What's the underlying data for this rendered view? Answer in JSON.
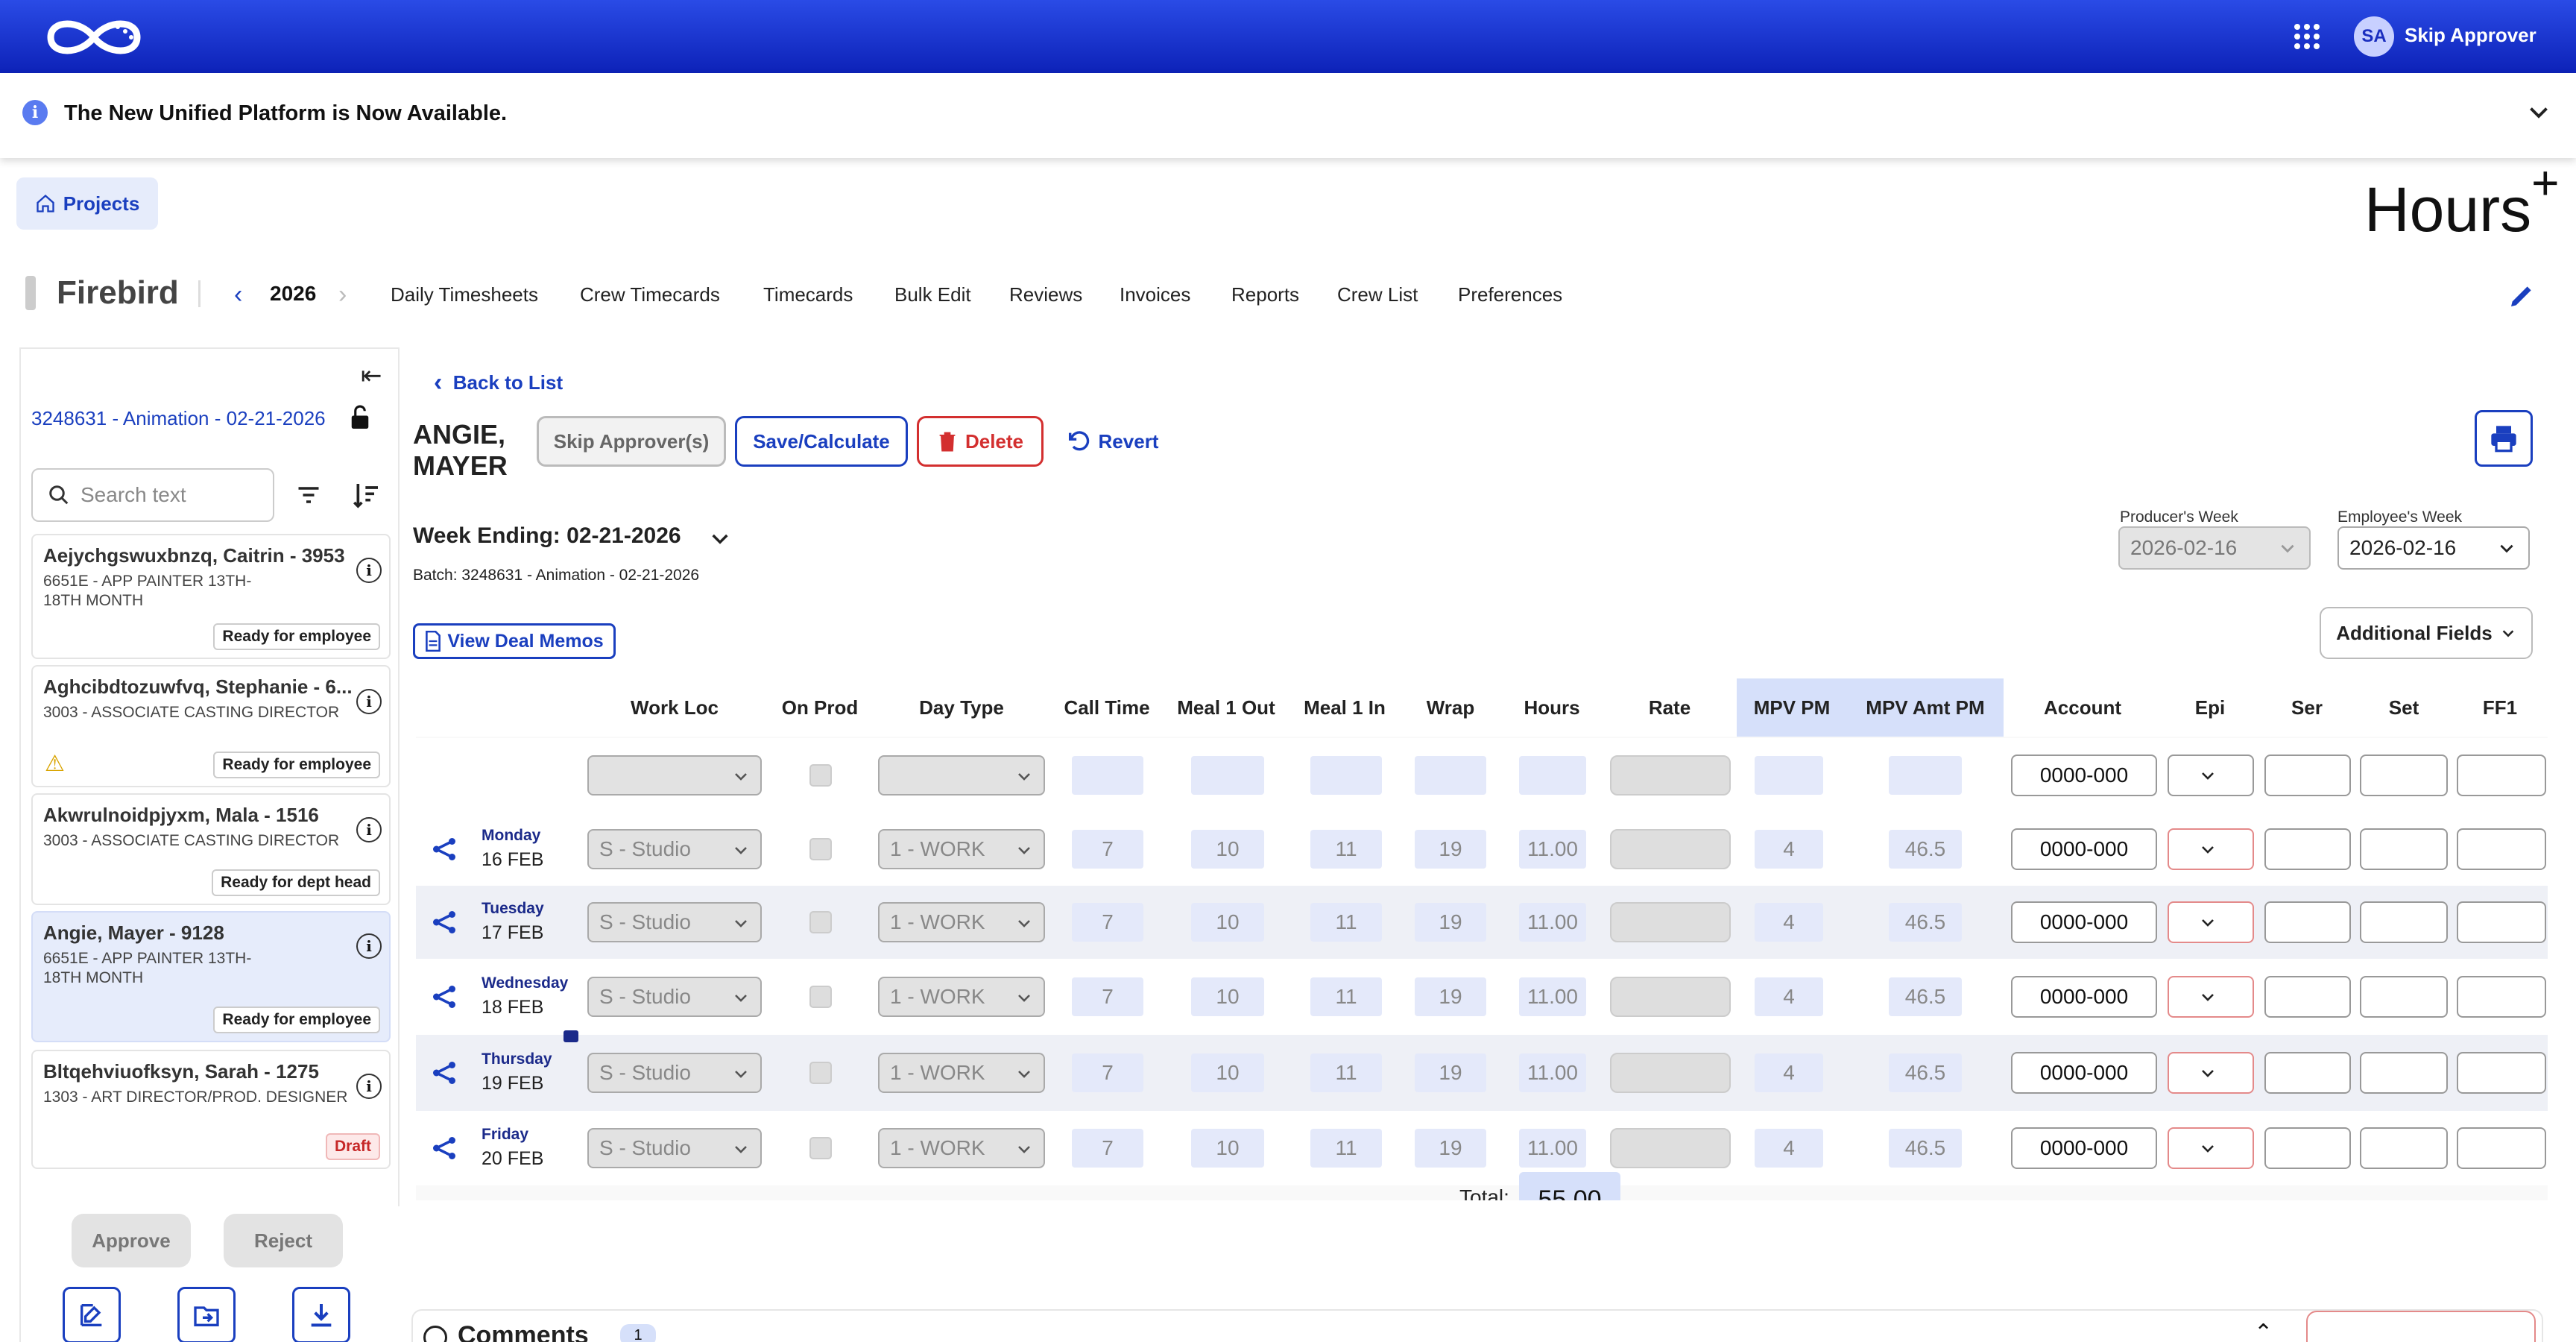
{
  "header": {
    "user_initials": "SA",
    "user_name": "Skip Approver"
  },
  "banner": {
    "text": "The New Unified Platform is Now Available."
  },
  "projects_button": "Projects",
  "brand": {
    "name": "Hours",
    "sup": "+"
  },
  "nav": {
    "project": "Firebird",
    "year": "2026",
    "links": [
      "Daily Timesheets",
      "Crew Timecards",
      "Timecards",
      "Bulk Edit",
      "Reviews",
      "Invoices",
      "Reports",
      "Crew List",
      "Preferences"
    ]
  },
  "sidebar": {
    "batch": "3248631 - Animation - 02-21-2026",
    "search_placeholder": "Search text",
    "employees": [
      {
        "name": "Aejychgswuxbnzq, Caitrin - 3953",
        "role": "6651E - APP PAINTER 13TH-18TH MONTH",
        "status": "Ready for employee"
      },
      {
        "name": "Aghcibdtozuwfvq, Stephanie - 6...",
        "role": "3003 - ASSOCIATE CASTING DIRECTOR",
        "status": "Ready for employee"
      },
      {
        "name": "Akwrulnoidpjyxm, Mala - 1516",
        "role": "3003 - ASSOCIATE CASTING DIRECTOR",
        "status": "Ready for dept head"
      },
      {
        "name": "Angie, Mayer - 9128",
        "role": "6651E - APP PAINTER 13TH-18TH MONTH",
        "status": "Ready for employee"
      },
      {
        "name": "Bltqehviuofksyn, Sarah - 1275",
        "role": "1303 - ART DIRECTOR/PROD. DESIGNER",
        "status": "Draft"
      }
    ],
    "approve": "Approve",
    "reject": "Reject"
  },
  "main": {
    "back": "Back to List",
    "employee_name": "ANGIE, MAYER",
    "buttons": {
      "skip": "Skip Approver(s)",
      "save": "Save/Calculate",
      "delete": "Delete",
      "revert": "Revert"
    },
    "week_ending": "Week Ending: 02-21-2026",
    "batch_line": "Batch: 3248631 - Animation - 02-21-2026",
    "producers_week_label": "Producer's Week",
    "producers_week": "2026-02-16",
    "employees_week_label": "Employee's Week",
    "employees_week": "2026-02-16",
    "deal_memos": "View Deal Memos",
    "additional_fields": "Additional Fields",
    "columns": [
      "Work Loc",
      "On Prod",
      "Day Type",
      "Call Time",
      "Meal 1 Out",
      "Meal 1 In",
      "Wrap",
      "Hours",
      "Rate",
      "MPV PM",
      "MPV Amt PM",
      "Account",
      "Epi",
      "Ser",
      "Set",
      "FF1"
    ],
    "blank_account": "0000-000",
    "days": [
      {
        "day": "Monday",
        "date": "16 FEB",
        "work_loc": "S - Studio",
        "day_type": "1 - WORK",
        "call": "7",
        "meal_out": "10",
        "meal_in": "11",
        "wrap": "19",
        "hours": "11.00",
        "mpv": "4",
        "mpv_amt": "46.5",
        "account": "0000-000"
      },
      {
        "day": "Tuesday",
        "date": "17 FEB",
        "work_loc": "S - Studio",
        "day_type": "1 - WORK",
        "call": "7",
        "meal_out": "10",
        "meal_in": "11",
        "wrap": "19",
        "hours": "11.00",
        "mpv": "4",
        "mpv_amt": "46.5",
        "account": "0000-000"
      },
      {
        "day": "Wednesday",
        "date": "18 FEB",
        "work_loc": "S - Studio",
        "day_type": "1 - WORK",
        "call": "7",
        "meal_out": "10",
        "meal_in": "11",
        "wrap": "19",
        "hours": "11.00",
        "mpv": "4",
        "mpv_amt": "46.5",
        "account": "0000-000"
      },
      {
        "day": "Thursday",
        "date": "19 FEB",
        "work_loc": "S - Studio",
        "day_type": "1 - WORK",
        "call": "7",
        "meal_out": "10",
        "meal_in": "11",
        "wrap": "19",
        "hours": "11.00",
        "mpv": "4",
        "mpv_amt": "46.5",
        "account": "0000-000"
      },
      {
        "day": "Friday",
        "date": "20 FEB",
        "work_loc": "S - Studio",
        "day_type": "1 - WORK",
        "call": "7",
        "meal_out": "10",
        "meal_in": "11",
        "wrap": "19",
        "hours": "11.00",
        "mpv": "4",
        "mpv_amt": "46.5",
        "account": "0000-000"
      }
    ],
    "total_label": "Total:",
    "total": "55.00",
    "comments_label": "Comments",
    "comments_count": "1"
  }
}
